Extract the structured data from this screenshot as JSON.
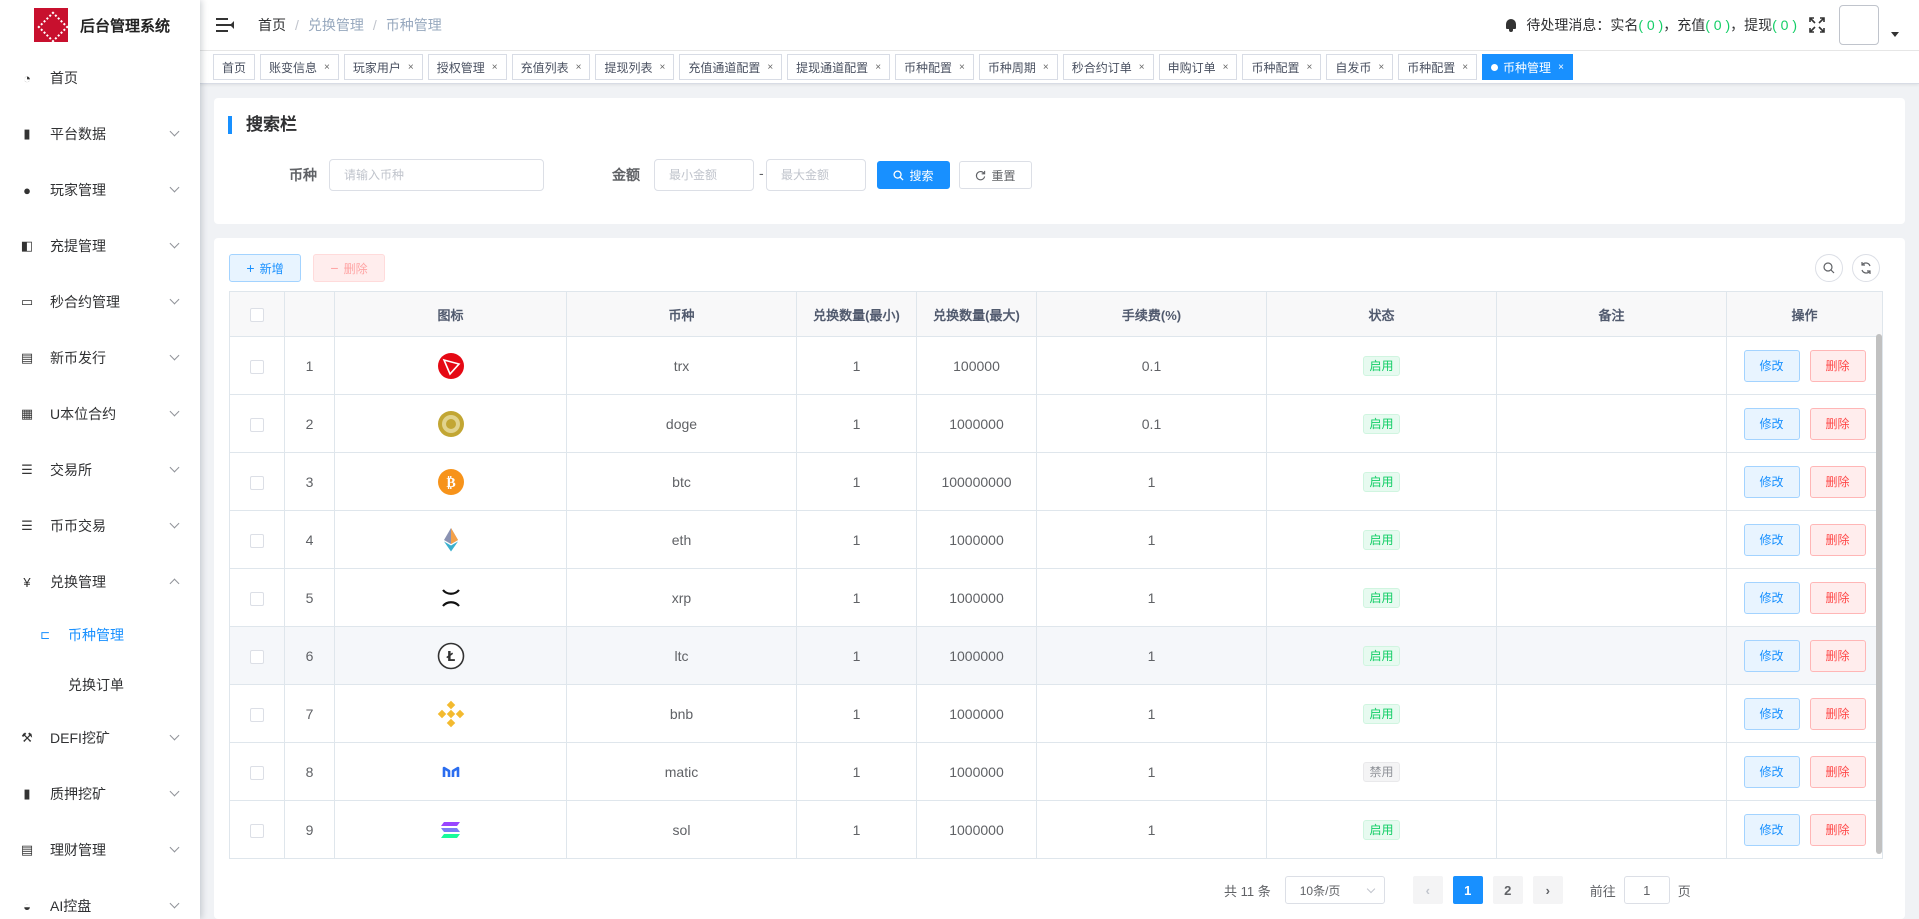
{
  "app": {
    "title": "后台管理系统"
  },
  "sidebar": {
    "items": [
      {
        "label": "首页",
        "icon": "dashboard-icon"
      },
      {
        "label": "平台数据",
        "icon": "data-icon"
      },
      {
        "label": "玩家管理",
        "icon": "user-icon"
      },
      {
        "label": "充提管理",
        "icon": "wallet-icon"
      },
      {
        "label": "秒合约管理",
        "icon": "monitor-icon"
      },
      {
        "label": "新币发行",
        "icon": "card-icon"
      },
      {
        "label": "U本位合约",
        "icon": "grid-icon"
      },
      {
        "label": "交易所",
        "icon": "list-icon"
      },
      {
        "label": "币币交易",
        "icon": "list-icon"
      },
      {
        "label": "兑换管理",
        "icon": "yen-icon"
      }
    ],
    "sub_items": [
      {
        "label": "币种管理",
        "icon": "tree-icon"
      },
      {
        "label": "兑换订单"
      }
    ],
    "bottom_items": [
      {
        "label": "DEFI挖矿",
        "icon": "mining-icon"
      },
      {
        "label": "质押挖矿",
        "icon": "bar-chart-icon"
      },
      {
        "label": "理财管理",
        "icon": "document-icon"
      },
      {
        "label": "AI控盘",
        "icon": "robot-icon"
      }
    ]
  },
  "topbar": {
    "breadcrumb": [
      "首页",
      "兑换管理",
      "币种管理"
    ],
    "notice_label": "待处理消息：实名",
    "realname_count": "( 0 )",
    "recharge_label": "，充值",
    "recharge_count": "( 0 )",
    "withdraw_label": "，提现",
    "withdraw_count": "( 0 )"
  },
  "tags": [
    "首页",
    "账变信息",
    "玩家用户",
    "授权管理",
    "充值列表",
    "提现列表",
    "充值通道配置",
    "提现通道配置",
    "币种配置",
    "币种周期",
    "秒合约订单",
    "申购订单",
    "币种配置",
    "自发币",
    "币种配置",
    "币种管理"
  ],
  "search": {
    "title": "搜索栏",
    "coin_label": "币种",
    "coin_placeholder": "请输入币种",
    "amount_label": "金额",
    "min_placeholder": "最小金额",
    "dash": "-",
    "max_placeholder": "最大金额",
    "search_btn": "搜索",
    "reset_btn": "重置"
  },
  "toolbar": {
    "add_label": "新增",
    "delete_label": "删除"
  },
  "table": {
    "headers": [
      "图标",
      "币种",
      "兑换数量(最小)",
      "兑换数量(最大)",
      "手续费(%)",
      "状态",
      "备注",
      "操作"
    ],
    "edit_label": "修改",
    "delete_label": "删除",
    "rows": [
      {
        "no": "1",
        "coin": "trx",
        "min": "1",
        "max": "100000",
        "fee": "0.1",
        "status": "启用",
        "remark": "",
        "icon": "trx"
      },
      {
        "no": "2",
        "coin": "doge",
        "min": "1",
        "max": "1000000",
        "fee": "0.1",
        "status": "启用",
        "remark": "",
        "icon": "doge"
      },
      {
        "no": "3",
        "coin": "btc",
        "min": "1",
        "max": "100000000",
        "fee": "1",
        "status": "启用",
        "remark": "",
        "icon": "btc"
      },
      {
        "no": "4",
        "coin": "eth",
        "min": "1",
        "max": "1000000",
        "fee": "1",
        "status": "启用",
        "remark": "",
        "icon": "eth"
      },
      {
        "no": "5",
        "coin": "xrp",
        "min": "1",
        "max": "1000000",
        "fee": "1",
        "status": "启用",
        "remark": "",
        "icon": "xrp"
      },
      {
        "no": "6",
        "coin": "ltc",
        "min": "1",
        "max": "1000000",
        "fee": "1",
        "status": "启用",
        "remark": "",
        "icon": "ltc"
      },
      {
        "no": "7",
        "coin": "bnb",
        "min": "1",
        "max": "1000000",
        "fee": "1",
        "status": "启用",
        "remark": "",
        "icon": "bnb"
      },
      {
        "no": "8",
        "coin": "matic",
        "min": "1",
        "max": "1000000",
        "fee": "1",
        "status": "禁用",
        "remark": "",
        "icon": "matic"
      },
      {
        "no": "9",
        "coin": "sol",
        "min": "1",
        "max": "1000000",
        "fee": "1",
        "status": "启用",
        "remark": "",
        "icon": "sol"
      }
    ]
  },
  "pagination": {
    "total": "共 11 条",
    "page_size": "10条/页",
    "pages": [
      "1",
      "2"
    ],
    "goto_label": "前往",
    "goto_value": "1",
    "page_suffix": "页"
  },
  "colors": {
    "primary": "#1890ff",
    "success": "#13ce66",
    "danger": "#ff4949",
    "brand": "#c8102e"
  }
}
